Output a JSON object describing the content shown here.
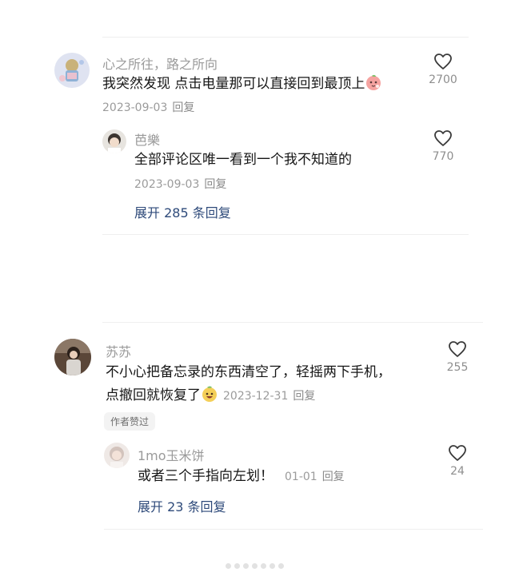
{
  "comments": [
    {
      "author": "心之所往，路之所向",
      "text": "我突然发现 点击电量那可以直接回到最顶上",
      "date": "2023-09-03",
      "reply_label": "回复",
      "likes": "2700",
      "emoji": "peach-face-emoji",
      "replies": [
        {
          "author": "芭樂",
          "text": "全部评论区唯一看到一个我不知道的",
          "date": "2023-09-03",
          "reply_label": "回复",
          "likes": "770"
        }
      ],
      "expand_label": "展开 285 条回复"
    },
    {
      "author": "苏苏",
      "text_line1": "不小心把备忘录的东西清空了，轻摇两下手机，",
      "text_line2": "点撤回就恢复了",
      "date": "2023-12-31",
      "reply_label": "回复",
      "likes": "255",
      "emoji": "grinning-fruit-emoji",
      "badge": "作者赞过",
      "replies": [
        {
          "author": "1mo玉米饼",
          "text": "或者三个手指向左划！",
          "date": "01-01",
          "reply_label": "回复",
          "likes": "24"
        }
      ],
      "expand_label": "展开 23 条回复"
    }
  ],
  "icons": {
    "like": "heart-outline-icon"
  },
  "colors": {
    "link": "#2e4a7a",
    "secondary_text": "#9a9a9a",
    "divider": "#efefef"
  }
}
